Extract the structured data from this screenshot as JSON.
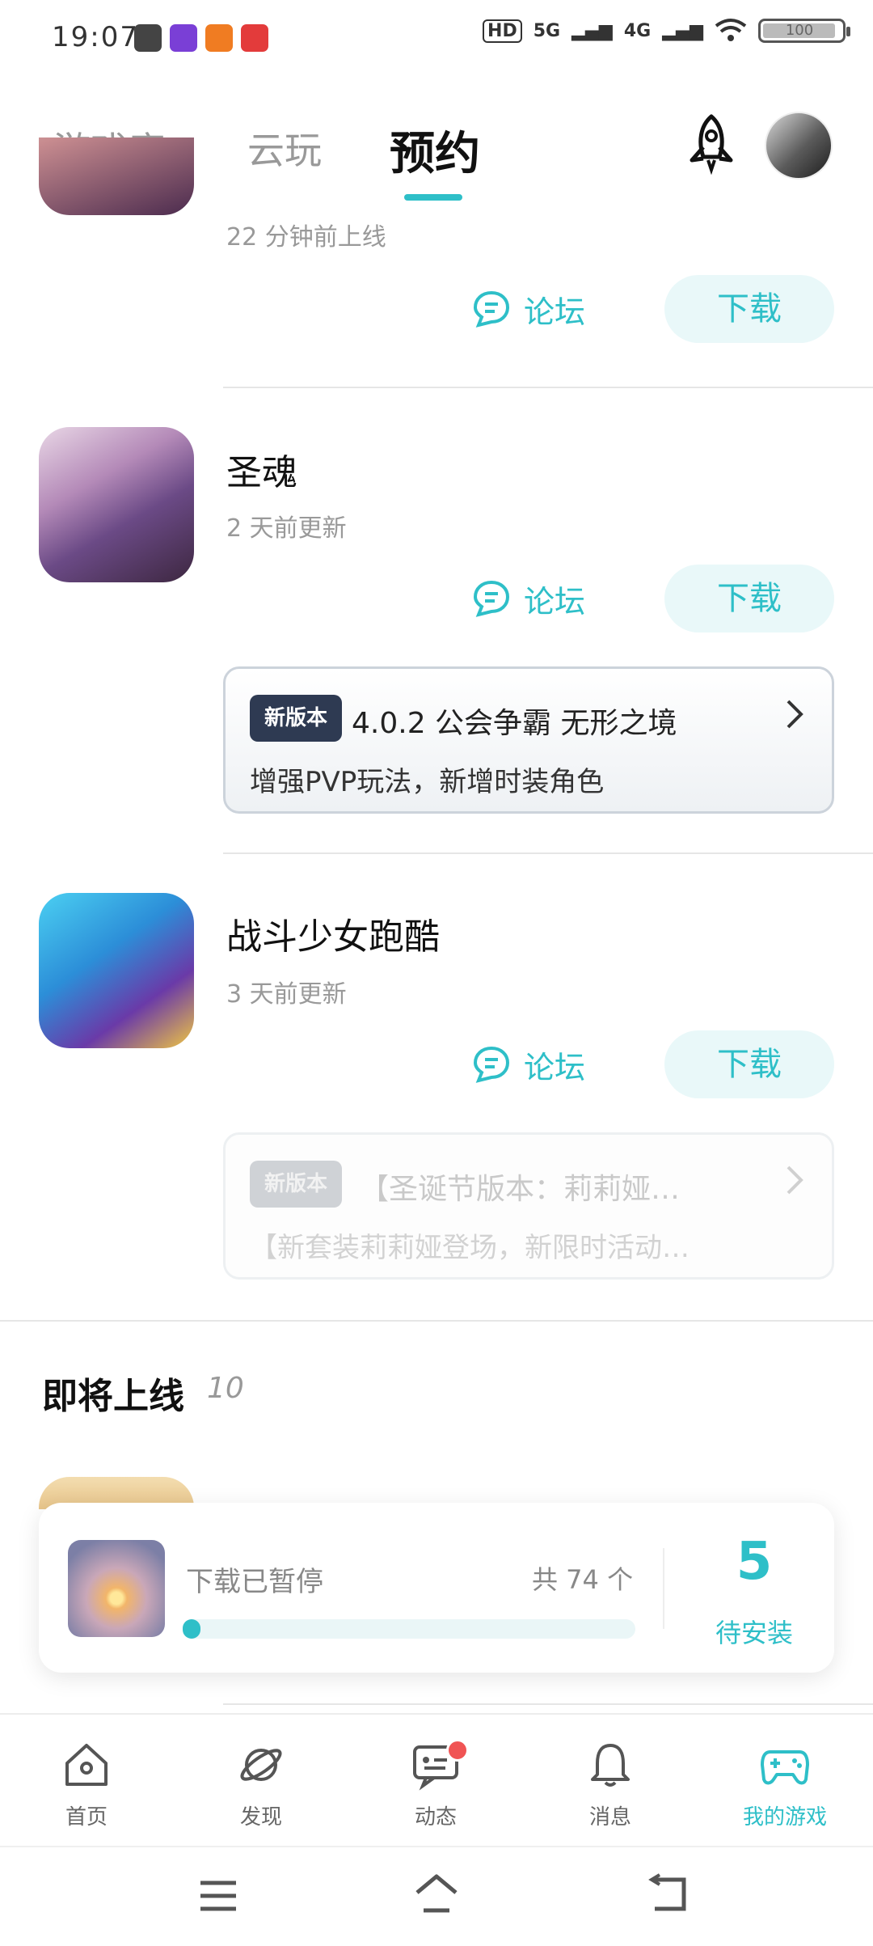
{
  "status_bar": {
    "time": "19:07",
    "network_labels": [
      "HD",
      "5G",
      "4G"
    ],
    "battery": "100"
  },
  "header": {
    "tabs": [
      {
        "label": "游戏库",
        "active": false
      },
      {
        "label": "云玩",
        "active": false
      },
      {
        "label": "预约",
        "active": true
      }
    ],
    "accent_color": "#2ebfc8"
  },
  "games": [
    {
      "name": "",
      "subtitle": "22 分钟前上线",
      "forum_label": "论坛",
      "download_label": "下载"
    },
    {
      "name": "圣魂",
      "subtitle": "2 天前更新",
      "forum_label": "论坛",
      "download_label": "下载",
      "update": {
        "badge": "新版本",
        "title": "4.0.2 公会争霸 无形之境",
        "desc": "增强PVP玩法，新增时装角色"
      }
    },
    {
      "name": "战斗少女跑酷",
      "subtitle": "3 天前更新",
      "forum_label": "论坛",
      "download_label": "下载",
      "update": {
        "badge": "新版本",
        "title": "【圣诞节版本：莉莉娅…",
        "desc": "【新套装莉莉娅登场，新限时活动…"
      }
    }
  ],
  "upcoming": {
    "title": "即将上线",
    "count": "10"
  },
  "download_panel": {
    "status": "下载已暂停",
    "total": "共 74 个",
    "progress_fraction": 0.04,
    "pending_count": "5",
    "pending_label": "待安装"
  },
  "bottom_nav": [
    {
      "label": "首页",
      "icon": "home-icon"
    },
    {
      "label": "发现",
      "icon": "planet-icon"
    },
    {
      "label": "动态",
      "icon": "chat-icon",
      "has_badge": true
    },
    {
      "label": "消息",
      "icon": "bell-icon"
    },
    {
      "label": "我的游戏",
      "icon": "gamepad-icon",
      "active": true
    }
  ]
}
